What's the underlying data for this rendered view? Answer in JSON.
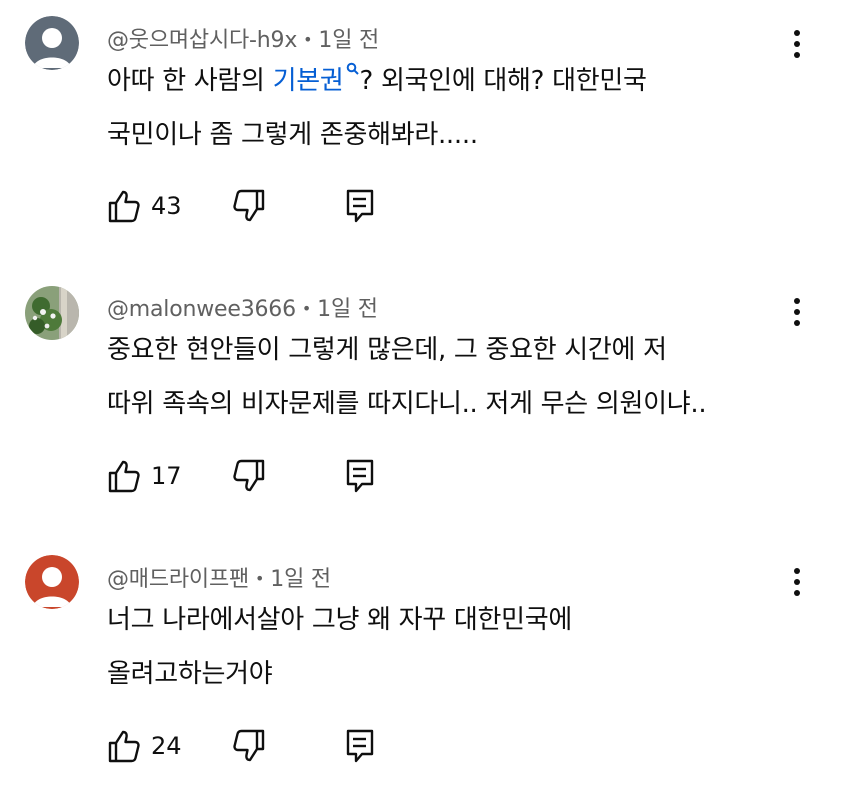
{
  "comments": [
    {
      "author": "@웃으며삽시다-h9x",
      "separator": "•",
      "time": "1일 전",
      "avatar_color": "#5f6b78",
      "line1_a": "아따 한 사람의 ",
      "line1_link": "기본권",
      "link_icon": "search-icon",
      "line1_b": "? 외국인에 대해? 대한민국",
      "line2": "국민이나 좀 그렇게 존중해봐라.....",
      "likes": "43"
    },
    {
      "author": "@malonwee3666",
      "separator": "•",
      "time": "1일 전",
      "avatar_color": "#6d8a5a",
      "line1": "중요한 현안들이 그렇게 많은데, 그 중요한 시간에 저",
      "line2": "따위 족속의 비자문제를 따지다니.. 저게 무슨 의원이냐..",
      "likes": "17"
    },
    {
      "author": "@매드라이프팬",
      "separator": "•",
      "time": "1일 전",
      "avatar_color": "#c9462b",
      "line1": "너그 나라에서살아 그냥 왜 자꾸 대한민국에",
      "line2": "올려고하는거야",
      "likes": "24"
    }
  ],
  "icons": {
    "like": "thumbs-up-icon",
    "dislike": "thumbs-down-icon",
    "reply": "reply-icon",
    "menu": "more-vert-icon"
  },
  "colors": {
    "link": "#065fd4",
    "meta": "#606060",
    "text": "#0f0f0f"
  }
}
